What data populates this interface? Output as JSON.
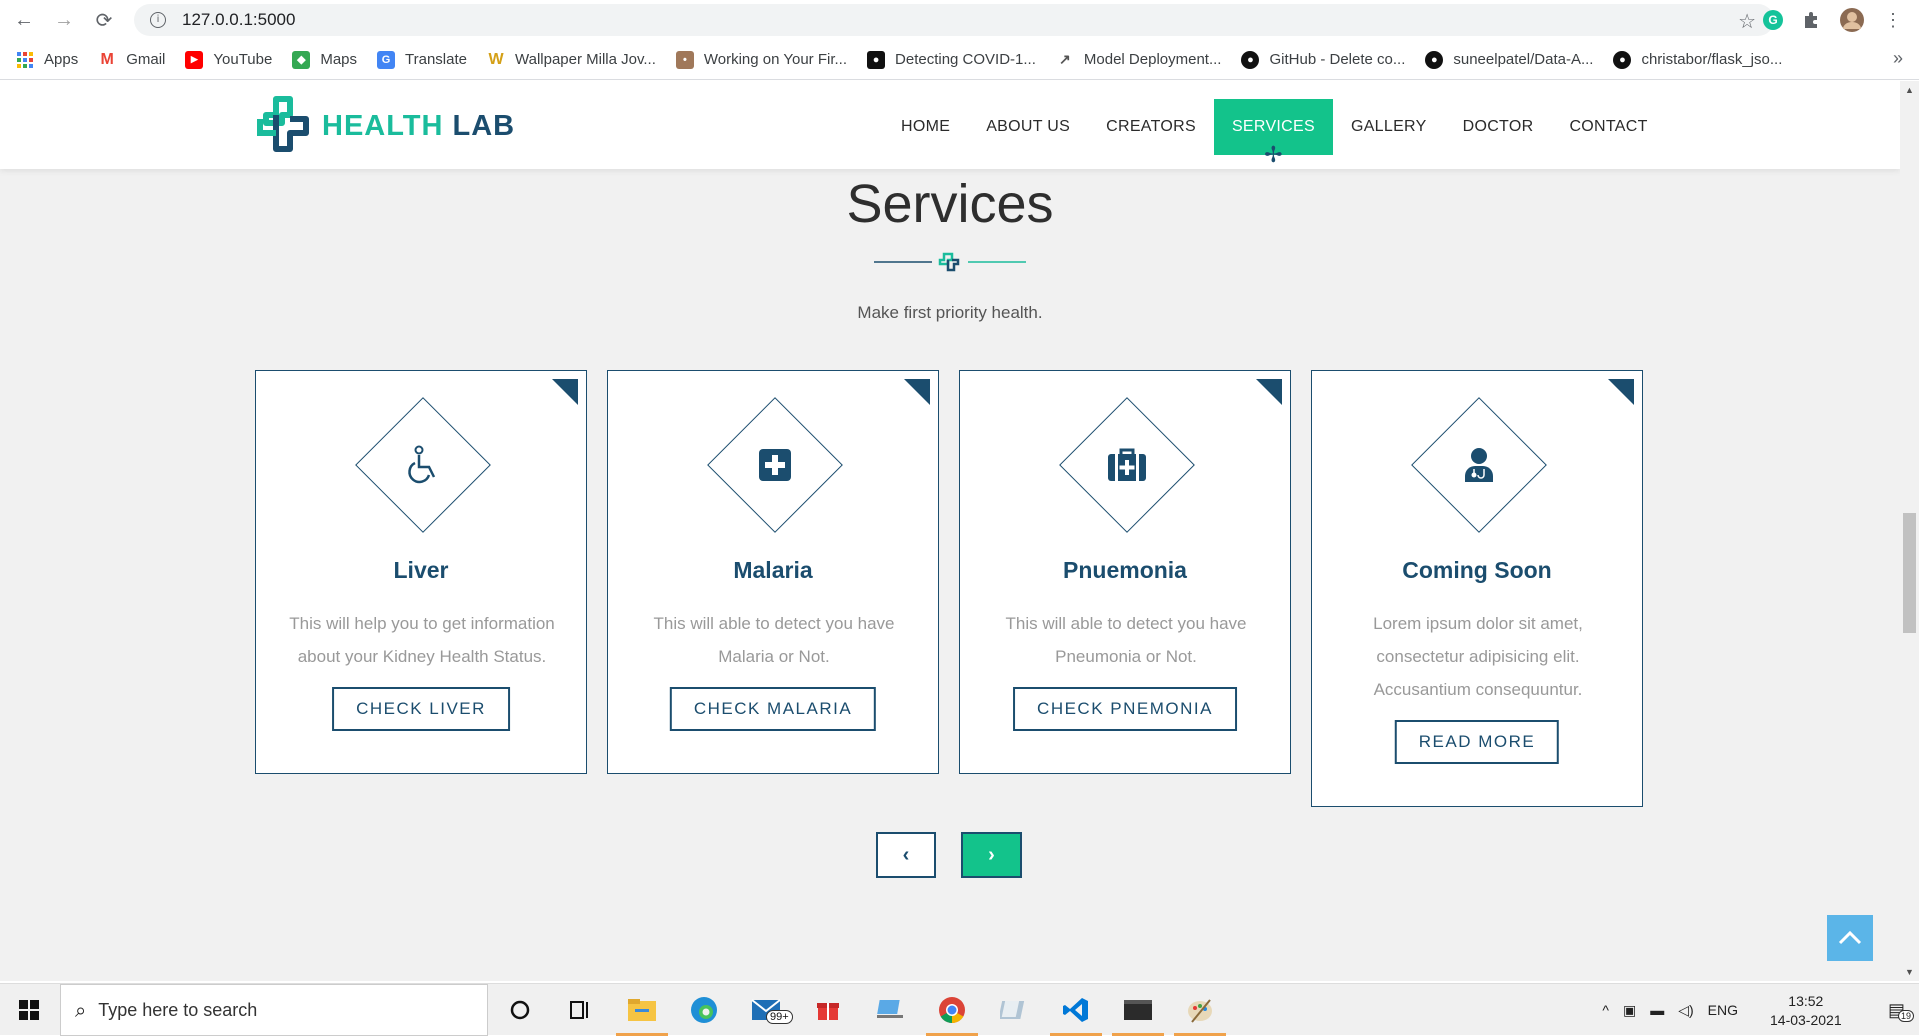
{
  "browser": {
    "url": "127.0.0.1:5000",
    "bookmarks": [
      {
        "label": "Apps",
        "icon": "apps-grid-icon",
        "color": "#4285f4"
      },
      {
        "label": "Gmail",
        "icon": "gmail-icon",
        "color": "#ea4335"
      },
      {
        "label": "YouTube",
        "icon": "youtube-icon",
        "color": "#ff0000"
      },
      {
        "label": "Maps",
        "icon": "maps-icon",
        "color": "#34a853"
      },
      {
        "label": "Translate",
        "icon": "translate-icon",
        "color": "#4285f4"
      },
      {
        "label": "Wallpaper Milla Jov...",
        "icon": "w-icon",
        "color": "#d4a017"
      },
      {
        "label": "Working on Your Fir...",
        "icon": "avatar-icon",
        "color": "#a0785a"
      },
      {
        "label": "Detecting COVID-1...",
        "icon": "video-icon",
        "color": "#111111"
      },
      {
        "label": "Model Deployment...",
        "icon": "chart-icon",
        "color": "#555555"
      },
      {
        "label": "GitHub - Delete co...",
        "icon": "github-icon",
        "color": "#111111"
      },
      {
        "label": "suneelpatel/Data-A...",
        "icon": "github-icon",
        "color": "#111111"
      },
      {
        "label": "christabor/flask_jso...",
        "icon": "github-icon",
        "color": "#111111"
      }
    ],
    "more": "»"
  },
  "site": {
    "logo_health": "HEALTH",
    "logo_lab": "LAB",
    "menu": [
      "HOME",
      "ABOUT US",
      "CREATORS",
      "SERVICES",
      "GALLERY",
      "DOCTOR",
      "CONTACT"
    ],
    "active_menu": "SERVICES",
    "colors": {
      "primary": "#1b4d6e",
      "accent": "#13c38b",
      "back_to_top": "#5bb5e8"
    }
  },
  "services": {
    "title": "Services",
    "subtitle": "Make first priority health.",
    "cards": [
      {
        "title": "Liver",
        "desc": "This will help you to get information about your Kidney Health Status.",
        "button": "CHECK LIVER",
        "icon": "wheelchair-icon"
      },
      {
        "title": "Malaria",
        "desc": "This will able to detect you have Malaria or Not.",
        "button": "CHECK MALARIA",
        "icon": "medical-plus-icon"
      },
      {
        "title": "Pnuemonia",
        "desc": "This will able to detect you have Pneumonia or Not.",
        "button": "CHECK PNEMONIA",
        "icon": "first-aid-kit-icon"
      },
      {
        "title": "Coming Soon",
        "desc": "Lorem ipsum dolor sit amet, consectetur adipisicing elit. Accusantium consequuntur.",
        "button": "READ MORE",
        "icon": "doctor-icon"
      }
    ],
    "prev": "‹",
    "next": "›"
  },
  "taskbar": {
    "search_placeholder": "Type here to search",
    "mail_badge": "99+",
    "lang": "ENG",
    "time": "13:52",
    "date": "14-03-2021",
    "notifications": "19"
  }
}
